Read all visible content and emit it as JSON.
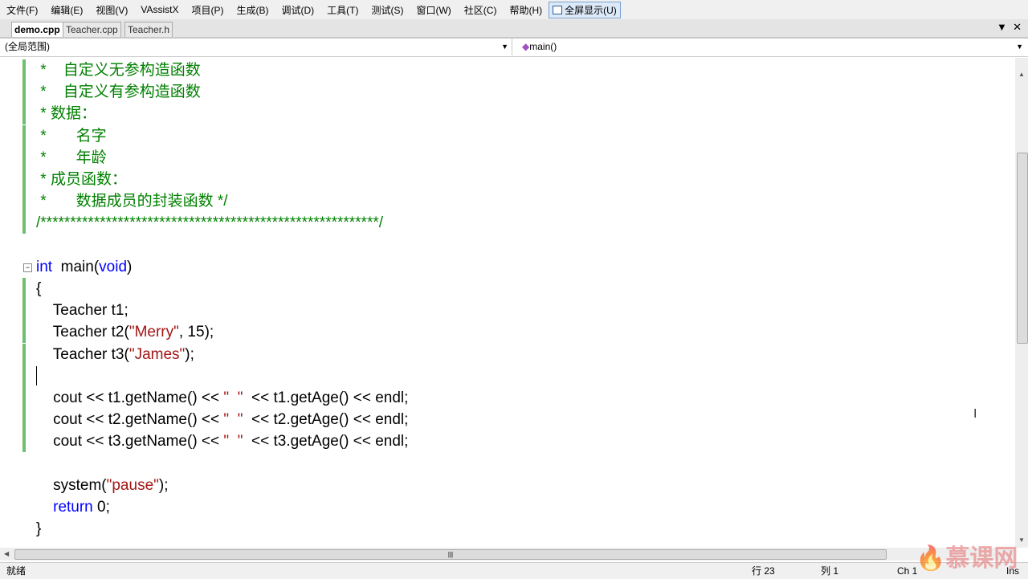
{
  "menu": [
    "文件(F)",
    "编辑(E)",
    "视图(V)",
    "VAssistX",
    "项目(P)",
    "生成(B)",
    "调试(D)",
    "工具(T)",
    "测试(S)",
    "窗口(W)",
    "社区(C)",
    "帮助(H)"
  ],
  "fullscreen": "全屏显示(U)",
  "tabs": [
    "demo.cpp",
    "Teacher.cpp",
    "Teacher.h"
  ],
  "scope": "(全局范围)",
  "func": "main()",
  "code": [
    [
      [
        "cm",
        " *    自定义无参构造函数"
      ]
    ],
    [
      [
        "cm",
        " *    自定义有参构造函数"
      ]
    ],
    [
      [
        "cm",
        " * 数据："
      ]
    ],
    [
      [
        "cm",
        " *       名字"
      ]
    ],
    [
      [
        "cm",
        " *       年龄"
      ]
    ],
    [
      [
        "cm",
        " * 成员函数："
      ]
    ],
    [
      [
        "cm",
        " *       数据成员的封装函数 */"
      ]
    ],
    [
      [
        "cm",
        "/*********************************************************/"
      ]
    ],
    [],
    [
      [
        "kw",
        "int"
      ],
      [
        "",
        "  main("
      ],
      [
        "kw",
        "void"
      ],
      [
        "",
        ")"
      ]
    ],
    [
      [
        "",
        "{"
      ]
    ],
    [
      [
        "",
        "    Teacher t1;"
      ]
    ],
    [
      [
        "",
        "    Teacher t2("
      ],
      [
        "st",
        "\"Merry\""
      ],
      [
        "",
        ", 15);"
      ]
    ],
    [
      [
        "",
        "    Teacher t3("
      ],
      [
        "st",
        "\"James\""
      ],
      [
        "",
        ");"
      ]
    ],
    [],
    [
      [
        "",
        "    cout << t1.getName() << "
      ],
      [
        "st",
        "\"  \""
      ],
      [
        "",
        "  << t1.getAge() << endl;"
      ]
    ],
    [
      [
        "",
        "    cout << t2.getName() << "
      ],
      [
        "st",
        "\"  \""
      ],
      [
        "",
        "  << t2.getAge() << endl;"
      ]
    ],
    [
      [
        "",
        "    cout << t3.getName() << "
      ],
      [
        "st",
        "\"  \""
      ],
      [
        "",
        "  << t3.getAge() << endl;"
      ]
    ],
    [],
    [
      [
        "",
        "    system("
      ],
      [
        "st",
        "\"pause\""
      ],
      [
        "",
        ");"
      ]
    ],
    [
      [
        "kw",
        "    return"
      ],
      [
        "",
        " 0;"
      ]
    ],
    [
      [
        "",
        "}"
      ]
    ]
  ],
  "status": {
    "ready": "就绪",
    "row": "行 23",
    "col": "列 1",
    "ch": "Ch 1",
    "ins": "Ins"
  },
  "watermark": "慕课网"
}
